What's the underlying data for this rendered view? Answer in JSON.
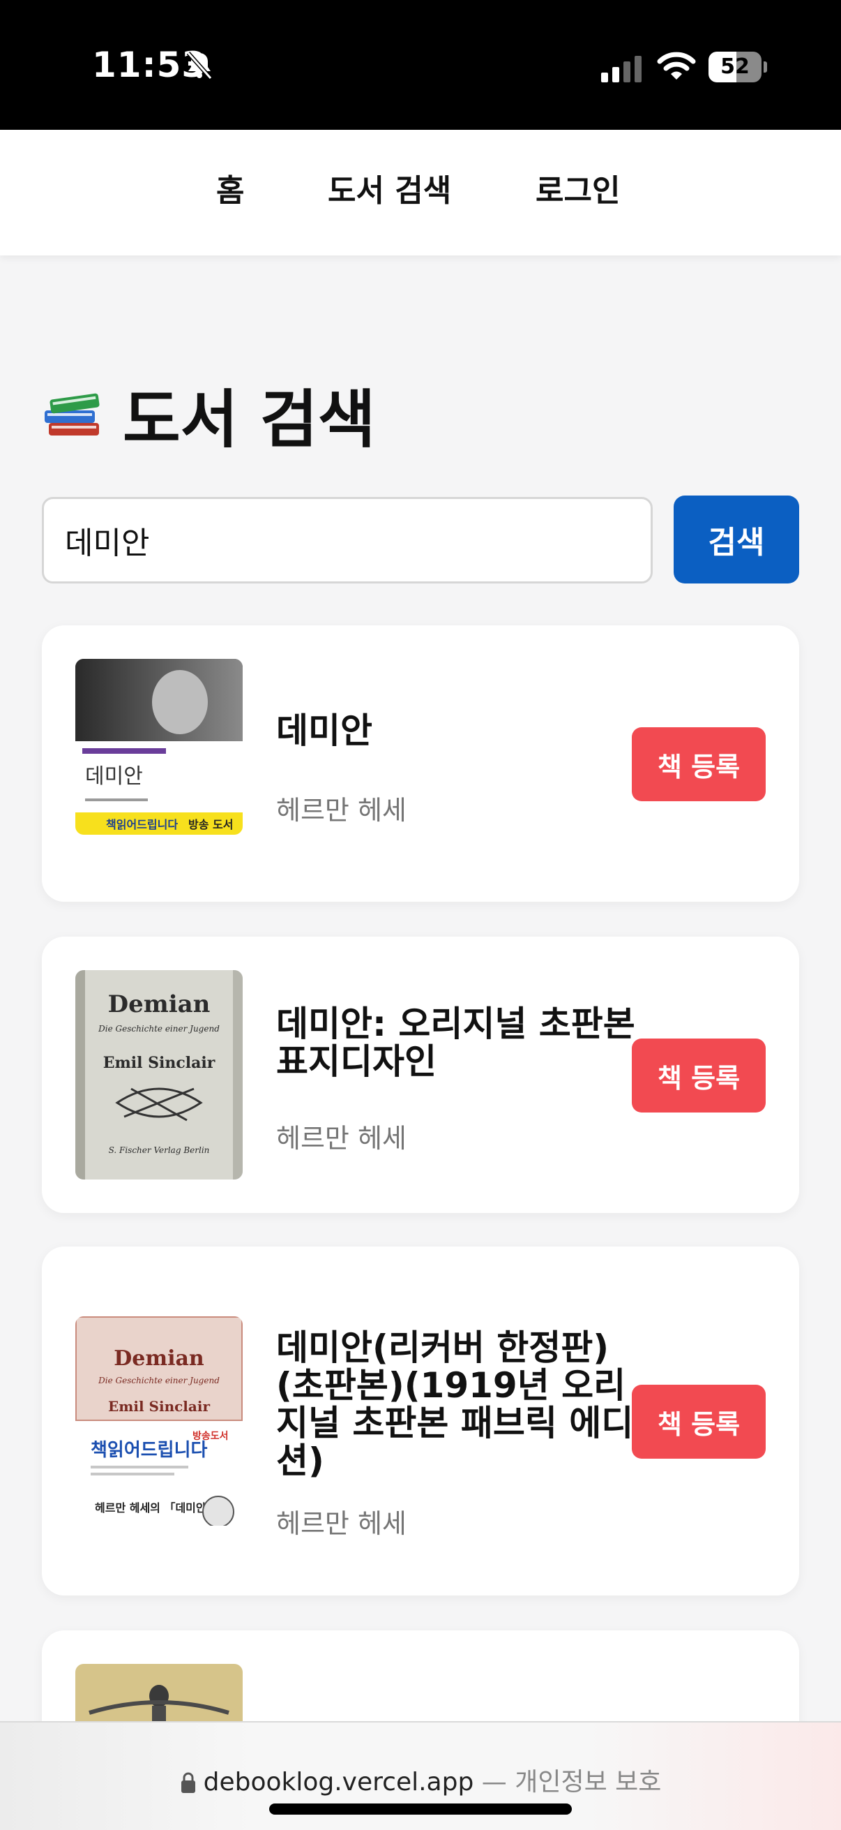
{
  "status_bar": {
    "time": "11:53",
    "battery": "52",
    "battery_level": 0.52
  },
  "nav": {
    "home": "홈",
    "book_search": "도서 검색",
    "login": "로그인"
  },
  "page": {
    "title": "도서 검색"
  },
  "search": {
    "value": "데미안",
    "button": "검색"
  },
  "results": [
    {
      "title": "데미안",
      "author": "헤르만 헤세",
      "button": "책 등록",
      "cover_text": {
        "name": "데미안",
        "banner": "책읽어드립니다",
        "banner_tag": "방송 도서"
      }
    },
    {
      "title": "데미안: 오리지널 초판본 표지디자인",
      "author": "헤르만 헤세",
      "button": "책 등록",
      "cover_text": {
        "title": "Demian",
        "subtitle": "Die Geschichte einer Jugend",
        "author": "Emil Sinclair",
        "publisher": "S. Fischer Verlag Berlin"
      }
    },
    {
      "title": "데미안(리커버 한정판)(초판본)(1919년 오리지널 초판본 패브릭 에디션)",
      "author": "헤르만 헤세",
      "button": "책 등록",
      "cover_text": {
        "title": "Demian",
        "subtitle": "Die Geschichte einer Jugend",
        "author": "Emil Sinclair",
        "banner": "책읽어드립니다",
        "banner_tag": "방송도서",
        "footer": "헤르만 헤세의 「데미안」"
      }
    }
  ],
  "url_bar": {
    "domain": "debooklog.vercel.app",
    "separator": "—",
    "suffix": "개인정보 보호"
  },
  "colors": {
    "search_button": "#0b5fc2",
    "register_button": "#f24a51",
    "background": "#f5f5f6"
  },
  "icons": [
    "bell-slash-icon",
    "signal-icon",
    "wifi-icon",
    "battery-icon",
    "books-icon",
    "lock-icon"
  ]
}
